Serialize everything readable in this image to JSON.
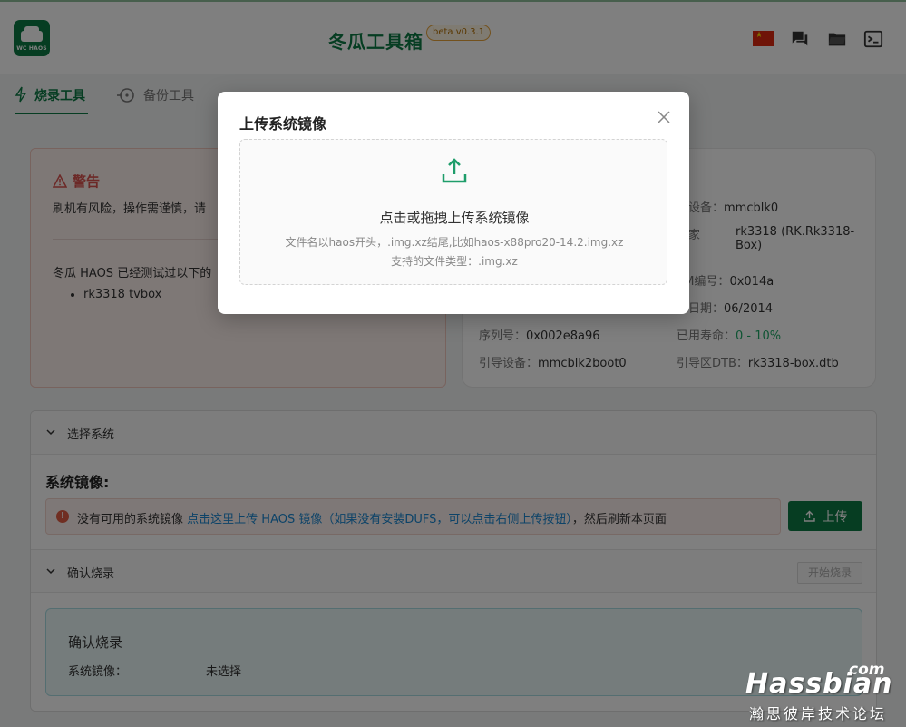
{
  "header": {
    "logo_text": "WC HAOS",
    "title": "冬瓜工具箱",
    "version": "beta v0.3.1",
    "flag_icon": "china-flag-icon",
    "colors": {
      "brand": "#0d7a45",
      "version_border": "#e6a33a"
    }
  },
  "tabs": [
    {
      "label": "烧录工具",
      "icon": "lightning-icon",
      "active": true
    },
    {
      "label": "备份工具",
      "icon": "backup-icon",
      "active": false
    }
  ],
  "warning": {
    "title": "警告",
    "text": "刷机有风险，操作需谨慎，请",
    "tested_intro": "冬瓜 HAOS 已经测试过以下的",
    "devices": [
      "rk3318 tvbox"
    ]
  },
  "device_info": {
    "source_label": "源设备：",
    "source_value": "mmcblk0",
    "family_label_1": "子家",
    "family_label_2": "：",
    "family_value_1": "rk3318 (RK.Rk3318-",
    "family_value_2": "Box)",
    "oem_label": "EM编号：",
    "oem_value": "0x014a",
    "date_label": "产日期：",
    "date_value": "06/2014",
    "serial_label": "序列号：",
    "serial_value": "0x002e8a96",
    "life_label": "已用寿命：",
    "life_value": "0 - 10%",
    "boot_label": "引导设备：",
    "boot_value": "mmcblk2boot0",
    "dtb_label": "引导区DTB：",
    "dtb_value": "rk3318-box.dtb"
  },
  "select_system": {
    "section_title": "选择系统",
    "image_label": "系统镜像:",
    "alert_text_1": "没有可用的系统镜像",
    "alert_link": "点击这里上传 HAOS 镜像（如果没有安装DUFS，可以点击右侧上传按钮）",
    "alert_text_2": "，然后刷新本页面",
    "upload_button": "上传"
  },
  "confirm": {
    "section_title": "确认烧录",
    "start_button": "开始烧录",
    "box_title": "确认烧录",
    "image_key": "系统镜像：",
    "image_value": "未选择"
  },
  "modal": {
    "title": "上传系统镜像",
    "drop_main": "点击或拖拽上传系统镜像",
    "drop_hint_1": "文件名以haos开头，.img.xz结尾,比如haos-x88pro20-14.2.img.xz",
    "drop_hint_2": "支持的文件类型：.img.xz"
  },
  "watermark": {
    "com": "com",
    "brand": "Hassbian",
    "cn": "瀚思彼岸技术论坛"
  }
}
